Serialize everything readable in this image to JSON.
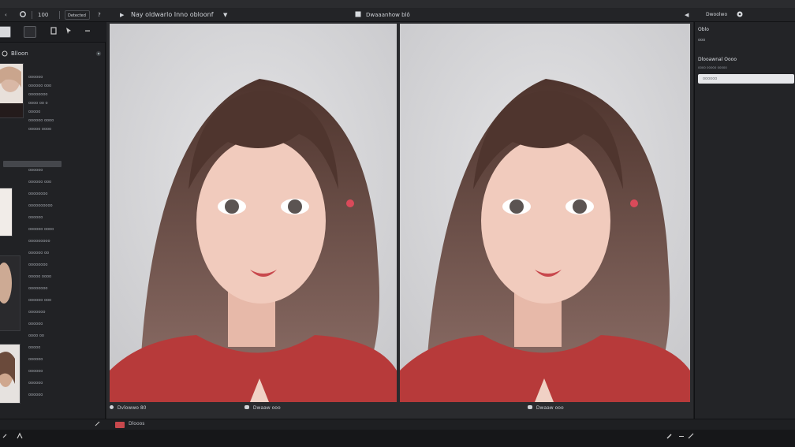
{
  "toolbar": {
    "back_glyph": "‹",
    "zoom_label": "100",
    "mode_label": "Detected",
    "help_glyph": "?",
    "play_glyph": "▶",
    "title": "Nay oldwarlo Inno obloonf",
    "dropdown_glyph": "▼",
    "file_label": "Dwaaanhow blô",
    "right_caret": "◀",
    "right_label": "Dwoolwo"
  },
  "left_panel": {
    "header": "Blloon",
    "thumb1_lines": [
      "oooooo",
      "oooooo ooo",
      "oooooooo",
      "oooo oo o",
      "ooooo",
      "oooooo oooo",
      "ooooo oooo"
    ],
    "list2_lines": [
      "oooooo",
      "oooooo ooo",
      "oooooooo",
      "oooooooooo",
      "oooooo",
      "oooooo oooo",
      "ooooooooo",
      "oooooo oo",
      "oooooooo",
      "ooooo oooo",
      "oooooooo",
      "oooooo ooo",
      "ooooooo",
      "oooooo",
      "oooo oo",
      "ooooo",
      "oooooo",
      "oooooo",
      "oooooo",
      "oooooo"
    ]
  },
  "viewer": {
    "caption_left": "Dvlowwo 80",
    "caption_center_left": "Dwaaw ooo",
    "caption_center_right": "Dwaaw ooo"
  },
  "right_panel": {
    "header": "Oblo",
    "sub": "ooo",
    "section": "Dlooawnal Oooo",
    "field_label": "oooo ooooo ooooo",
    "input_value": "oooooo"
  },
  "status": {
    "chip": "Dlooos"
  },
  "colors": {
    "accent_red": "#c8484d",
    "panel": "#212225",
    "sweater": "#b73a3a",
    "hair": "#5a3b33"
  }
}
